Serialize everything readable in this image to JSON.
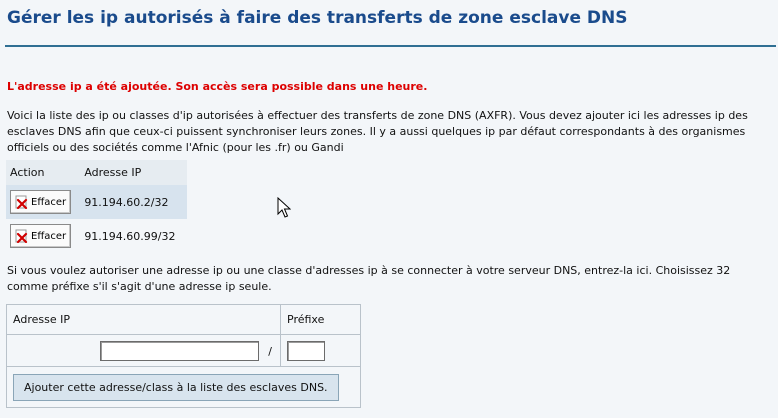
{
  "page": {
    "title": "Gérer les ip autorisés à faire des transferts de zone esclave DNS",
    "alert": "L'adresse ip a été ajoutée. Son accès sera possible dans une heure.",
    "intro": "Voici la liste des ip ou classes d'ip autorisées à effectuer des transferts de zone DNS (AXFR). Vous devez ajouter ici les adresses ip des esclaves DNS afin que ceux-ci puissent synchroniser leurs zones. Il y a aussi quelques ip par défaut correspondants à des organismes officiels ou des sociétés comme l'Afnic (pour les .fr) ou Gandi"
  },
  "list": {
    "col_action": "Action",
    "col_ip": "Adresse IP",
    "rows": [
      {
        "button": "Effacer",
        "ip": "91.194.60.2/32"
      },
      {
        "button": "Effacer",
        "ip": "91.194.60.99/32"
      }
    ]
  },
  "form": {
    "instructions": "Si vous voulez autoriser une adresse ip ou une classe d'adresses ip à se connecter à votre serveur DNS, entrez-la ici. Choisissez 32 comme préfixe s'il s'agit d'une adresse ip seule.",
    "col_ip": "Adresse IP",
    "col_prefix": "Préfixe",
    "separator": "/",
    "ip_value": "",
    "prefix_value": "",
    "submit_label": "Ajouter cette adresse/class à la liste des esclaves DNS."
  },
  "colors": {
    "title": "#1a4b8c",
    "alert": "#dd0000",
    "row_highlight": "#d7e3ee"
  },
  "icons": [
    "delete-x-icon",
    "mouse-cursor-icon"
  ]
}
